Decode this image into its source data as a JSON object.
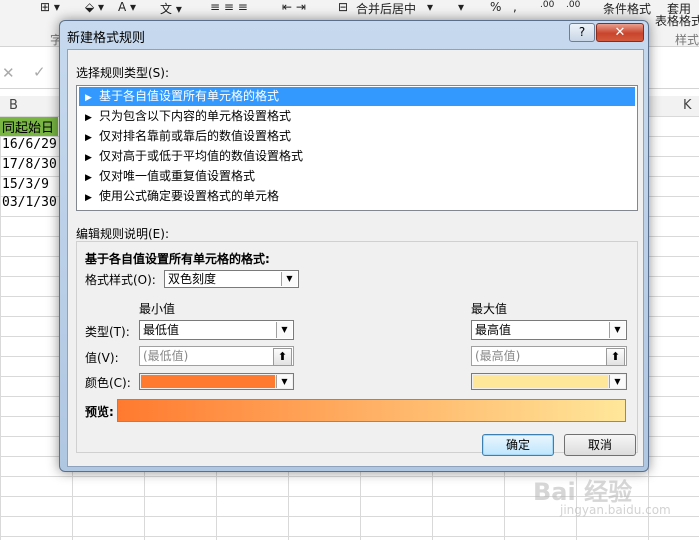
{
  "ribbon": {
    "merge_center": "合并后居中",
    "percent": "%",
    "comma": ",",
    "dec_inc": ".00",
    "dec_dec": ".00",
    "cond_format": "条件格式",
    "table_format_1": "套用",
    "table_format_2": "表格格式",
    "group_left": "字",
    "group_right": "样式"
  },
  "spreadsheet": {
    "col_b": "B",
    "col_k": "K",
    "cells_b": [
      "同起始日",
      "16/6/29",
      "17/8/30",
      "15/3/9",
      "03/1/30"
    ],
    "header_fill": "#78b542"
  },
  "dialog": {
    "title": "新建格式规则",
    "help": "?",
    "close": "✕",
    "select_type_label": "选择规则类型(S):",
    "rule_types": [
      "基于各自值设置所有单元格的格式",
      "只为包含以下内容的单元格设置格式",
      "仅对排名靠前或靠后的数值设置格式",
      "仅对高于或低于平均值的数值设置格式",
      "仅对唯一值或重复值设置格式",
      "使用公式确定要设置格式的单元格"
    ],
    "selected_rule_index": 0,
    "edit_label": "编辑规则说明(E):",
    "edit_heading": "基于各自值设置所有单元格的格式:",
    "format_style_label": "格式样式(O):",
    "format_style_value": "双色刻度",
    "min_header": "最小值",
    "max_header": "最大值",
    "type_label": "类型(T):",
    "min_type": "最低值",
    "max_type": "最高值",
    "value_label": "值(V):",
    "min_value_placeholder": "(最低值)",
    "max_value_placeholder": "(最高值)",
    "color_label": "颜色(C):",
    "min_color": "#ff7a2f",
    "max_color": "#ffe79a",
    "preview_label": "预览:",
    "ok": "确定",
    "cancel": "取消"
  },
  "watermark": {
    "brand": "Bai 经验",
    "url": "jingyan.baidu.com"
  }
}
